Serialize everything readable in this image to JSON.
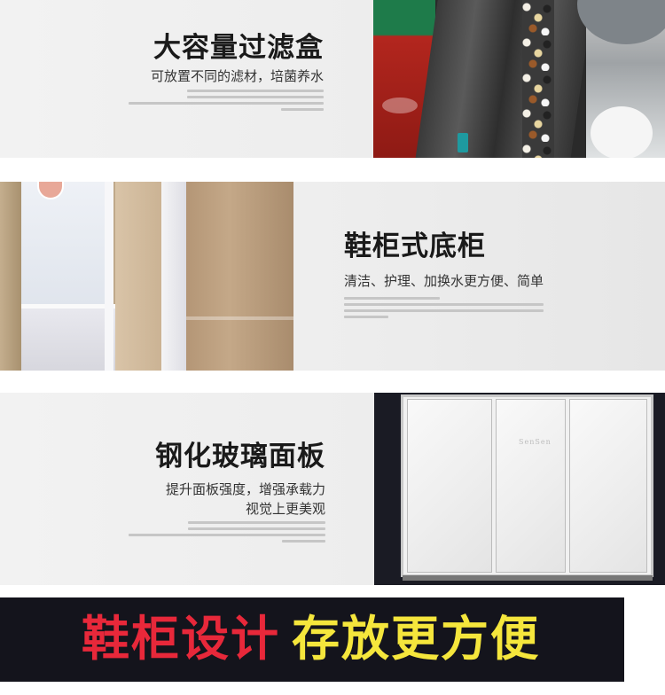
{
  "sections": [
    {
      "title": "大容量过滤盒",
      "subtitle": "可放置不同的滤材，培菌养水"
    },
    {
      "title": "鞋柜式底柜",
      "subtitle": "清洁、护理、加换水更方便、简单"
    },
    {
      "title": "钢化玻璃面板",
      "subtitle_line1": "提升面板强度，增强承载力",
      "subtitle_line2": "视觉上更美观",
      "brand_mark": "SenSen"
    }
  ],
  "banner": {
    "left_text": "鞋柜设计",
    "right_text": "存放更方便",
    "colors": {
      "left": "#e8283a",
      "right": "#f5e63c",
      "background": "#14141c"
    }
  }
}
